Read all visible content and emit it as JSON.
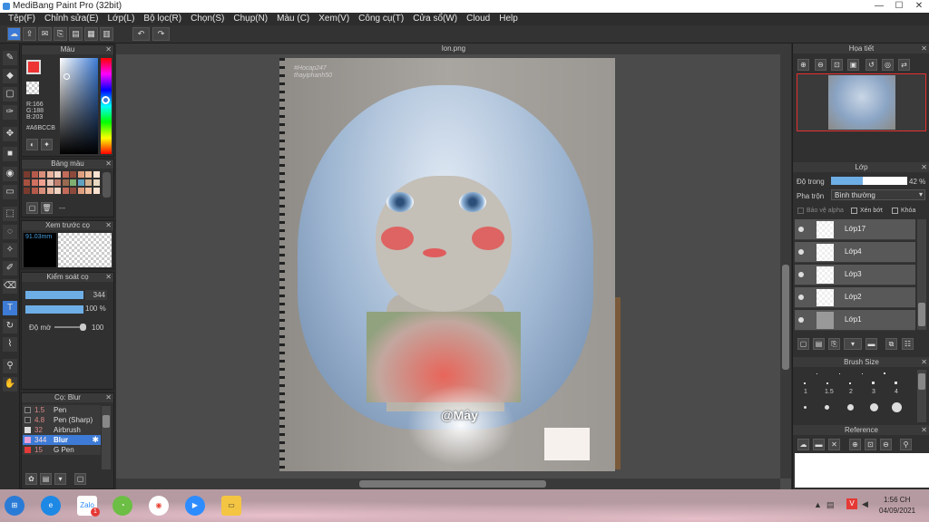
{
  "window": {
    "title": "MediBang Paint Pro (32bit)",
    "min": "—",
    "max": "☐",
    "close": "✕"
  },
  "menu": [
    "Tệp(F)",
    "Chỉnh sửa(E)",
    "Lớp(L)",
    "Bộ lọc(R)",
    "Chọn(S)",
    "Chụp(N)",
    "Màu (C)",
    "Xem(V)",
    "Công cụ(T)",
    "Cửa sổ(W)",
    "Cloud",
    "Help"
  ],
  "color_panel": {
    "title": "Màu",
    "r": "R:166",
    "g": "G:188",
    "b": "B:203",
    "hex": "#A6BCCB",
    "main_color": "#A6BCCB"
  },
  "palette_panel": {
    "title": "Bảng màu",
    "more": "---"
  },
  "preview_panel": {
    "title": "Xem trước cọ",
    "size": "91.03mm"
  },
  "brush_control": {
    "title": "Kiểm soát cọ",
    "size_value": "344",
    "opacity_value": "100 %",
    "blur_label": "Độ mờ",
    "blur_value": "100"
  },
  "brush_list": {
    "title": "Cọ: Blur",
    "items": [
      {
        "num": "1.5",
        "name": "Pen",
        "color": "#333333"
      },
      {
        "num": "4.8",
        "name": "Pen (Sharp)",
        "color": "#333333"
      },
      {
        "num": "32",
        "name": "Airbrush",
        "color": "#dddddd"
      },
      {
        "num": "344",
        "name": "Blur",
        "color": "#e6a0d8"
      },
      {
        "num": "15",
        "name": "G Pen",
        "color": "#e33a3a"
      }
    ]
  },
  "document": {
    "tab": "lon.png",
    "watermark1": "#Hocap247",
    "watermark2": "thayiphanh50",
    "signature": "@Mây"
  },
  "navigator": {
    "title": "Họa tiết"
  },
  "layer_panel": {
    "title": "Lớp",
    "opacity_label": "Độ trong",
    "opacity_value": "42 %",
    "opacity_fraction": 0.42,
    "blend_label": "Pha trộn",
    "blend_value": "Bình thường",
    "protect_alpha": "Bảo vệ alpha",
    "clipping": "Xén bớt",
    "lock": "Khóa",
    "layers": [
      {
        "name": "Lớp17"
      },
      {
        "name": "Lớp4"
      },
      {
        "name": "Lớp3"
      },
      {
        "name": "Lớp2"
      },
      {
        "name": "Lớp1"
      }
    ]
  },
  "brush_size": {
    "title": "Brush Size",
    "labels": [
      "1",
      "1.5",
      "2",
      "3",
      "4"
    ]
  },
  "reference": {
    "title": "Reference"
  },
  "taskbar": {
    "time": "1:56 CH",
    "date": "04/09/2021",
    "zoom_badge": "1"
  }
}
